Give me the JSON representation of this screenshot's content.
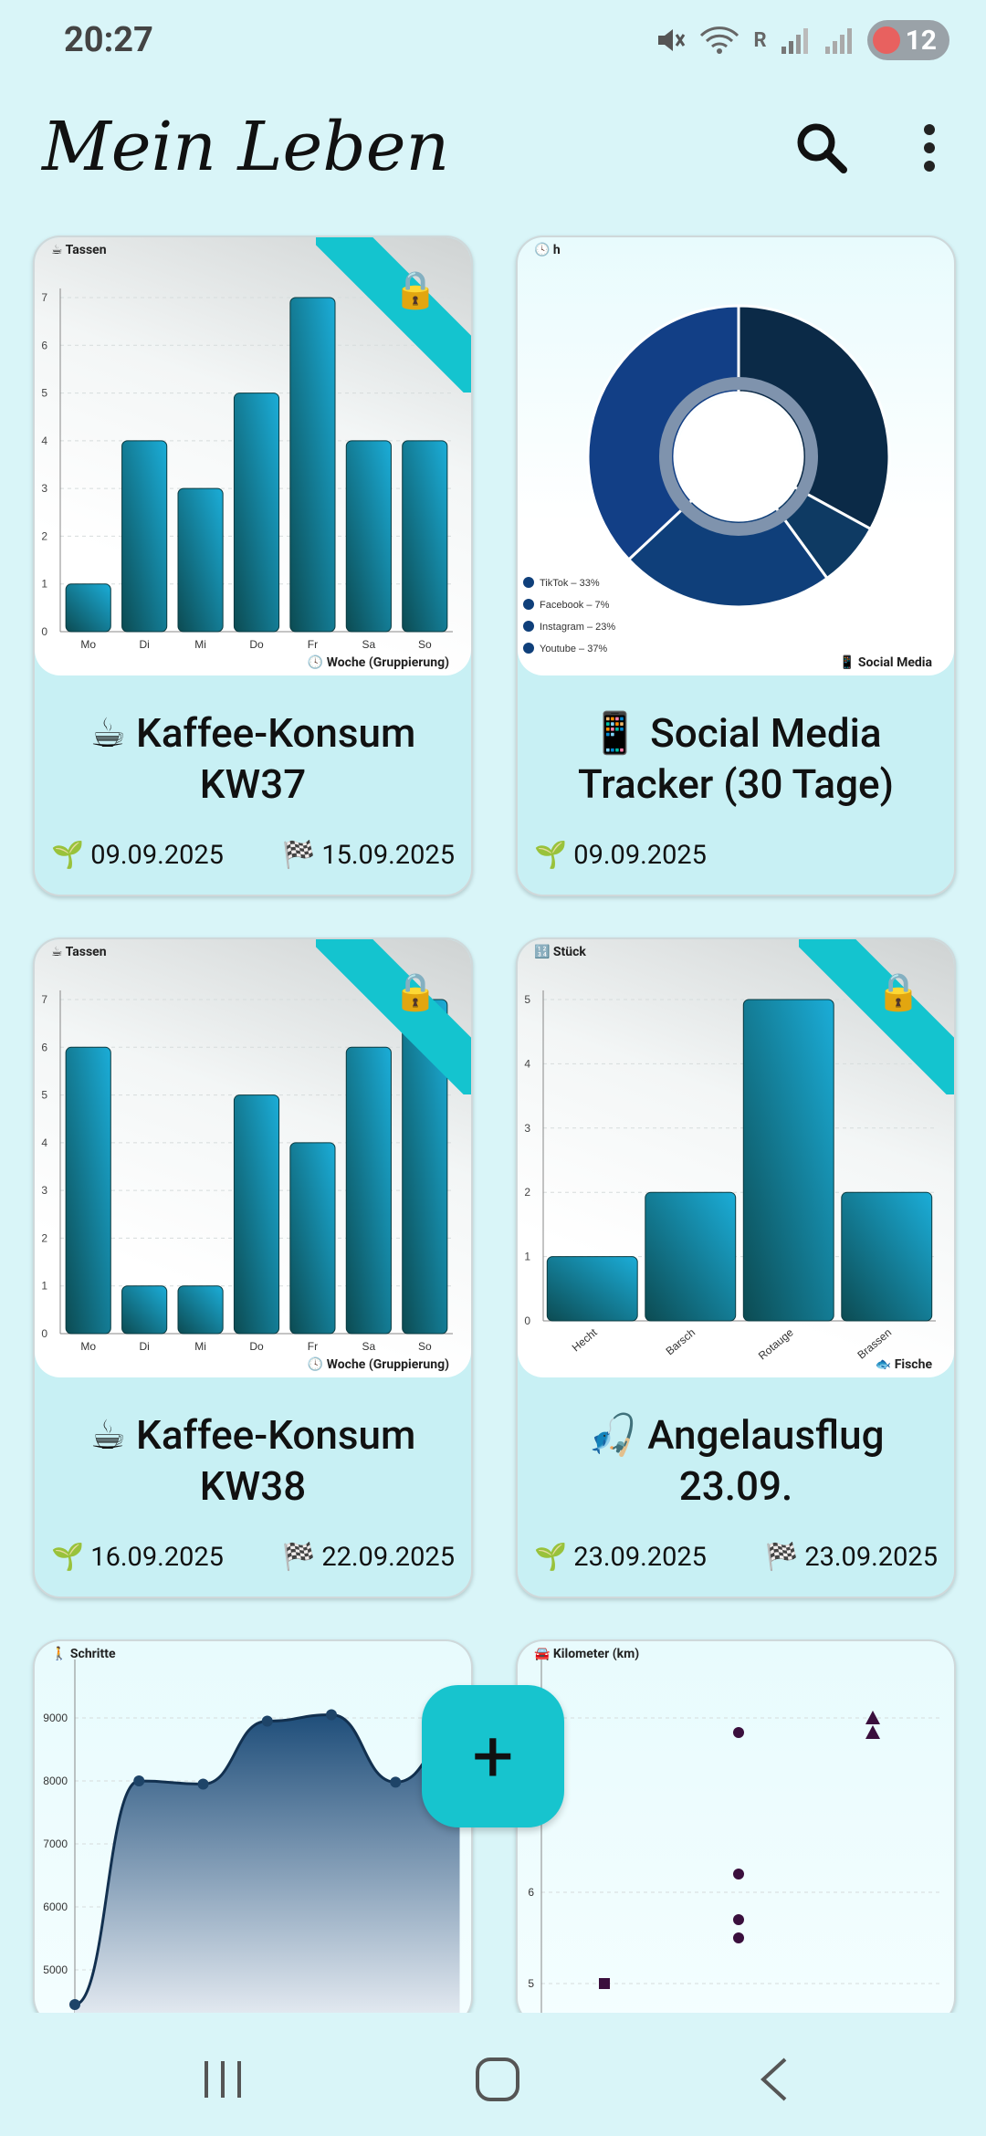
{
  "status_bar": {
    "time": "20:27",
    "signal_label": "R",
    "battery": "12"
  },
  "header": {
    "title": "Mein Leben",
    "search_icon": "search-icon",
    "menu_icon": "more-vert-icon"
  },
  "cards": [
    {
      "title_line1": "☕ Kaffee-Konsum",
      "title_line2": "KW37",
      "start": "🌱 09.09.2025",
      "end": "🏁 15.09.2025",
      "unit": "☕ Tassen",
      "footer": "🕓 Woche (Gruppierung)",
      "locked": true
    },
    {
      "title_line1": "📱 Social Media",
      "title_line2": "Tracker (30 Tage)",
      "start": "🌱 09.09.2025",
      "unit": "🕓 h",
      "footer": "📱 Social Media",
      "locked": false
    },
    {
      "title_line1": "☕ Kaffee-Konsum",
      "title_line2": "KW38",
      "start": "🌱 16.09.2025",
      "end": "🏁 22.09.2025",
      "unit": "☕ Tassen",
      "footer": "🕓 Woche (Gruppierung)",
      "locked": true
    },
    {
      "title_line1": "🎣 Angelausflug",
      "title_line2": "23.09.",
      "start": "🌱 23.09.2025",
      "end": "🏁 23.09.2025",
      "unit": "🔢 Stück",
      "footer": "🐟 Fische",
      "locked": true
    },
    {
      "unit": "🚶 Schritte"
    },
    {
      "unit": "🚘 Kilometer (km)"
    }
  ],
  "chart_data": [
    {
      "type": "bar",
      "categories": [
        "Mo",
        "Di",
        "Mi",
        "Do",
        "Fr",
        "Sa",
        "So"
      ],
      "values": [
        1,
        4,
        3,
        5,
        7,
        4,
        4
      ],
      "ylim": [
        0,
        7
      ],
      "ylabel": "Tassen",
      "xlabel": "Woche (Gruppierung)"
    },
    {
      "type": "pie",
      "categories": [
        "TikTok – 33%",
        "Facebook – 7%",
        "Instagram – 23%",
        "Youtube – 37%"
      ],
      "values": [
        33,
        7,
        23,
        37
      ],
      "title": "Social Media",
      "legend": "bottom-left"
    },
    {
      "type": "bar",
      "categories": [
        "Mo",
        "Di",
        "Mi",
        "Do",
        "Fr",
        "Sa",
        "So"
      ],
      "values": [
        6,
        1,
        1,
        5,
        4,
        6,
        7
      ],
      "ylim": [
        0,
        7
      ],
      "ylabel": "Tassen",
      "xlabel": "Woche (Gruppierung)"
    },
    {
      "type": "bar",
      "categories": [
        "Hecht",
        "Barsch",
        "Rotauge",
        "Brassen"
      ],
      "values": [
        1,
        2,
        5,
        2
      ],
      "ylim": [
        0,
        5
      ],
      "ylabel": "Stück",
      "xlabel": "Fische"
    },
    {
      "type": "area",
      "y_ticks": [
        5000,
        6000,
        7000,
        8000,
        9000
      ],
      "values": [
        4450,
        8000,
        7950,
        8950,
        9050,
        7980,
        8800
      ],
      "ylabel": "Schritte"
    },
    {
      "type": "scatter",
      "y_ticks": [
        5,
        6
      ],
      "series": [
        {
          "marker": "square",
          "points": [
            [
              1,
              5
            ]
          ]
        },
        {
          "marker": "circle",
          "points": [
            [
              2,
              9
            ],
            [
              2,
              6.2
            ],
            [
              2,
              5.7
            ],
            [
              2,
              5.5
            ]
          ]
        },
        {
          "marker": "triangle",
          "points": [
            [
              3,
              9.2
            ],
            [
              3,
              9
            ]
          ]
        }
      ],
      "ylabel": "Kilometer (km)"
    }
  ],
  "fab": {
    "label": "+"
  },
  "nav": {
    "recent_icon": "recent-apps-icon",
    "home_icon": "home-icon",
    "back_icon": "back-icon"
  },
  "colors": {
    "background": "#d9f5f8",
    "accent": "#17c4ce",
    "bar_dark": "#0e4d55",
    "bar_light": "#12b2e2",
    "pie_dark": "#0b2a47",
    "pie_mid": "#0f3f7a"
  }
}
